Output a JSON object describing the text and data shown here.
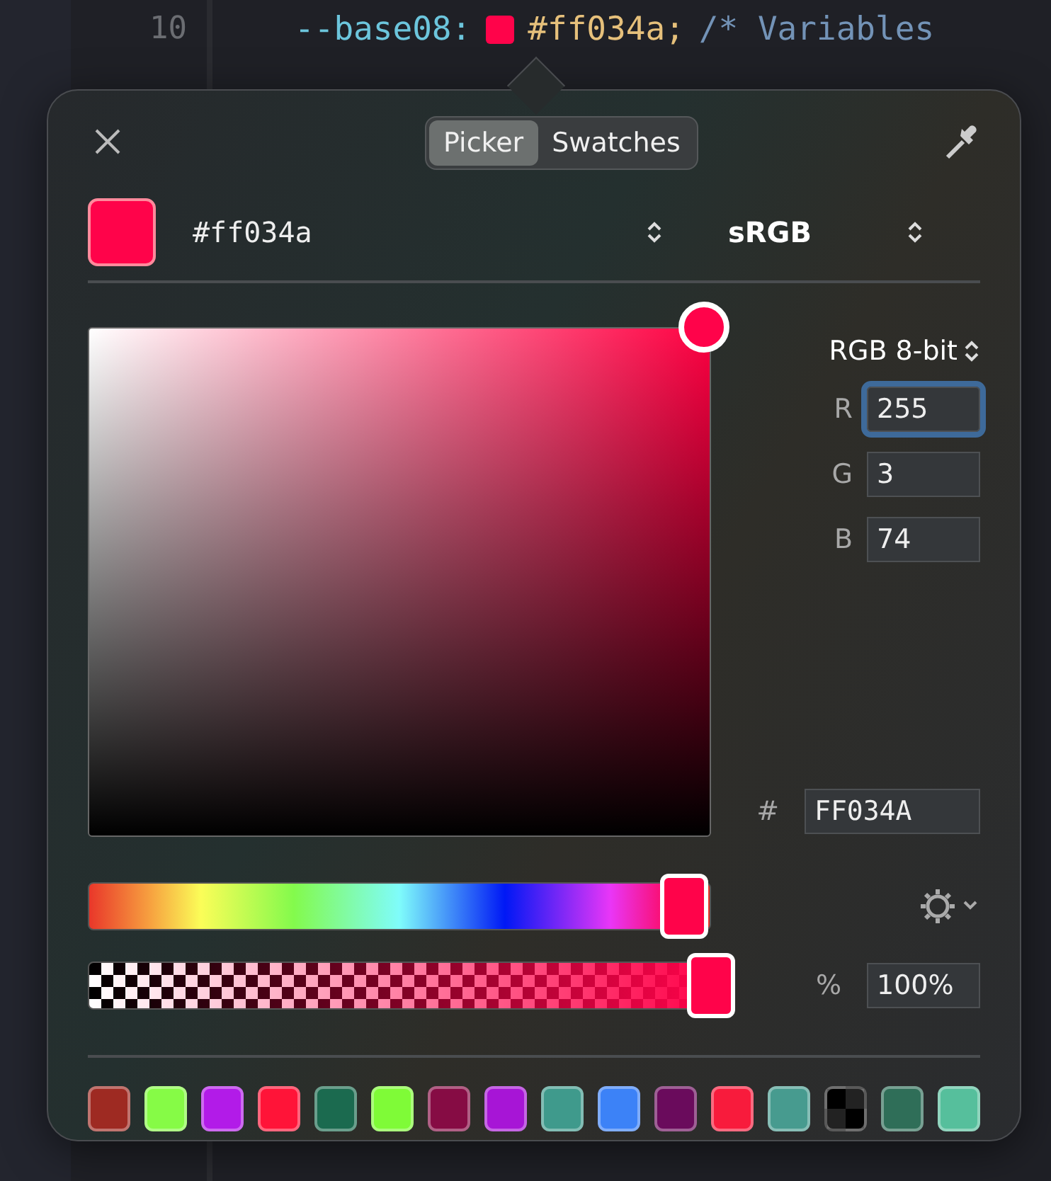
{
  "editor": {
    "line_number": "10",
    "property": "--base08:",
    "value": "#ff034a;",
    "comment": "/* Variables"
  },
  "picker": {
    "tabs": [
      {
        "label": "Picker",
        "selected": true
      },
      {
        "label": "Swatches",
        "selected": false
      }
    ],
    "color_value": "#ff034a",
    "color_space": "sRGB",
    "model": "RGB 8-bit",
    "channels": [
      {
        "label": "R",
        "value": "255",
        "focused": true
      },
      {
        "label": "G",
        "value": "3",
        "focused": false
      },
      {
        "label": "B",
        "value": "74",
        "focused": false
      }
    ],
    "hex_label": "#",
    "hex": "FF034A",
    "hue": {
      "level": 0.957
    },
    "opacity": {
      "level": 1,
      "label": "%",
      "value": "100%"
    },
    "swatches": [
      {
        "kind": "solid",
        "color": "#9e2a22"
      },
      {
        "kind": "solid",
        "color": "#86fb46"
      },
      {
        "kind": "solid",
        "color": "#b21be8"
      },
      {
        "kind": "solid",
        "color": "#ff1438"
      },
      {
        "kind": "solid",
        "color": "#1b6a4f"
      },
      {
        "kind": "solid",
        "color": "#7ffb37"
      },
      {
        "kind": "solid",
        "color": "#860c44"
      },
      {
        "kind": "solid",
        "color": "#a715d6"
      },
      {
        "kind": "solid",
        "color": "#3f9a8c"
      },
      {
        "kind": "solid",
        "color": "#3c82f7"
      },
      {
        "kind": "solid",
        "color": "#6a0b5c"
      },
      {
        "kind": "solid",
        "color": "#f81b3c"
      },
      {
        "kind": "solid",
        "color": "#479b8f"
      },
      {
        "kind": "checker",
        "color": "#000000"
      },
      {
        "kind": "solid",
        "color": "#2f6e58"
      },
      {
        "kind": "solid",
        "color": "#56bf9c"
      }
    ]
  }
}
